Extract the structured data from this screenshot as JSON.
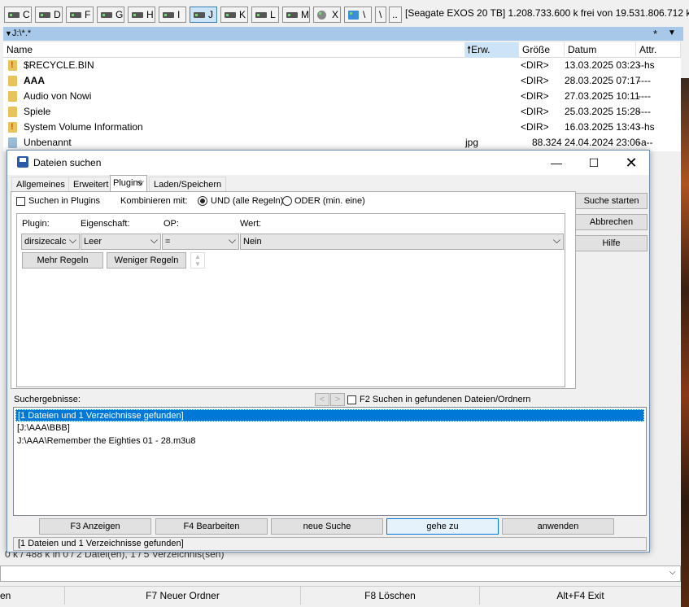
{
  "drives": [
    "C",
    "D",
    "F",
    "G",
    "H",
    "I",
    "J",
    "K",
    "L",
    "M",
    "X",
    "\\",
    ".."
  ],
  "active_drive": "J",
  "disk_info": "[Seagate EXOS 20 TB]  1.208.733.600 k frei von 19.531.806.712 k",
  "path": "J:\\*.*",
  "path_star": "*",
  "columns": {
    "name": "Name",
    "ext": "Erw.",
    "size": "Größe",
    "date": "Datum",
    "attr": "Attr."
  },
  "files": [
    {
      "name": "$RECYCLE.BIN",
      "ext": "",
      "size": "<DIR>",
      "date": "13.03.2025 03:23",
      "attr": "--hs",
      "icon": "system-folder-icon"
    },
    {
      "name": "AAA",
      "ext": "",
      "size": "<DIR>",
      "date": "28.03.2025 07:17",
      "attr": "----",
      "icon": "folder-icon"
    },
    {
      "name": "Audio von Nowi",
      "ext": "",
      "size": "<DIR>",
      "date": "27.03.2025 10:11",
      "attr": "----",
      "icon": "folder-icon"
    },
    {
      "name": "Spiele",
      "ext": "",
      "size": "<DIR>",
      "date": "25.03.2025 15:28",
      "attr": "----",
      "icon": "folder-icon"
    },
    {
      "name": "System Volume Information",
      "ext": "",
      "size": "<DIR>",
      "date": "16.03.2025 13:43",
      "attr": "--hs",
      "icon": "system-folder-icon"
    },
    {
      "name": "Unbenannt",
      "ext": "jpg",
      "size": "88.324",
      "date": "24.04.2024 23:06",
      "attr": "-a--",
      "icon": "image-file-icon"
    }
  ],
  "status": "0 k / 488 k in 0 / 2 Datei(en), 1 / 5 Verzeichnis(sen)",
  "fkeys": [
    "en",
    "F7 Neuer Ordner",
    "F8 Löschen",
    "Alt+F4 Exit"
  ],
  "dialog": {
    "title": "Dateien suchen",
    "tabs": [
      "Allgemeines",
      "Erweitert",
      "Plugins",
      "Laden/Speichern"
    ],
    "search_in_plugins": "Suchen in Plugins",
    "combine_label": "Kombinieren mit:",
    "and_label": "UND (alle Regeln)",
    "or_label": "ODER (min. eine)",
    "col_plugin": "Plugin:",
    "col_property": "Eigenschaft:",
    "col_op": "OP:",
    "col_value": "Wert:",
    "rule": {
      "plugin": "dirsizecalc",
      "property": "Leer",
      "op": "=",
      "value": "Nein"
    },
    "more_rules": "Mehr Regeln",
    "fewer_rules": "Weniger Regeln",
    "start_search": "Suche starten",
    "cancel": "Abbrechen",
    "help": "Hilfe",
    "results_label": "Suchergebnisse:",
    "search_in_found": "F2 Suchen in gefundenen Dateien/Ordnern",
    "results": [
      "[1 Dateien und 1 Verzeichnisse gefunden]",
      "[J:\\AAA\\BBB]",
      "J:\\AAA\\Remember the Eighties 01 - 28.m3u8"
    ],
    "buttons": [
      "F3 Anzeigen",
      "F4 Bearbeiten",
      "neue Suche",
      "gehe zu",
      "anwenden"
    ],
    "status": "[1 Dateien und 1 Verzeichnisse gefunden]"
  }
}
